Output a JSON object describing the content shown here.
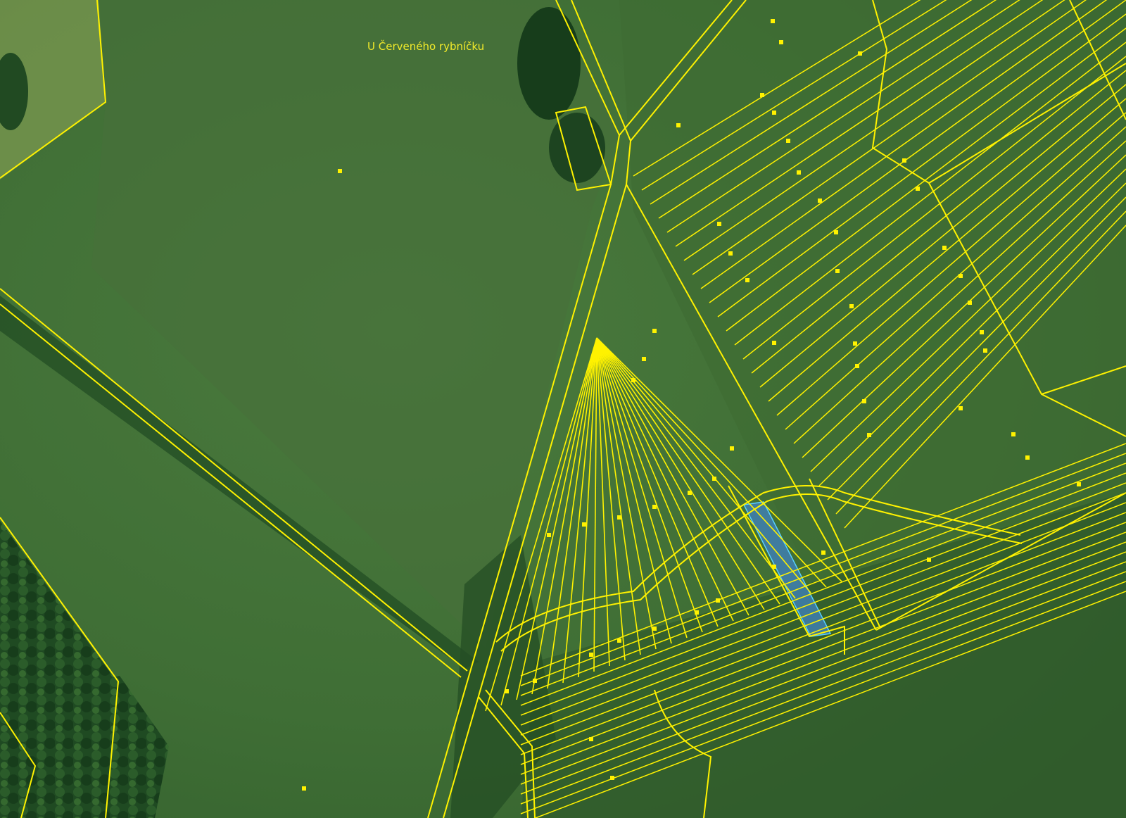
{
  "map": {
    "locality_label": "U Červeného rybníčku",
    "colors": {
      "parcel_boundary": "#fff200",
      "meadow": "#3d6b34",
      "forest": "#1f4a22",
      "water": "#3f7fb0"
    },
    "features": [
      "aerial-orthophoto",
      "cadastral-parcel-boundaries",
      "parcel-definition-point-markers",
      "water-body-parcel",
      "field-track"
    ]
  }
}
